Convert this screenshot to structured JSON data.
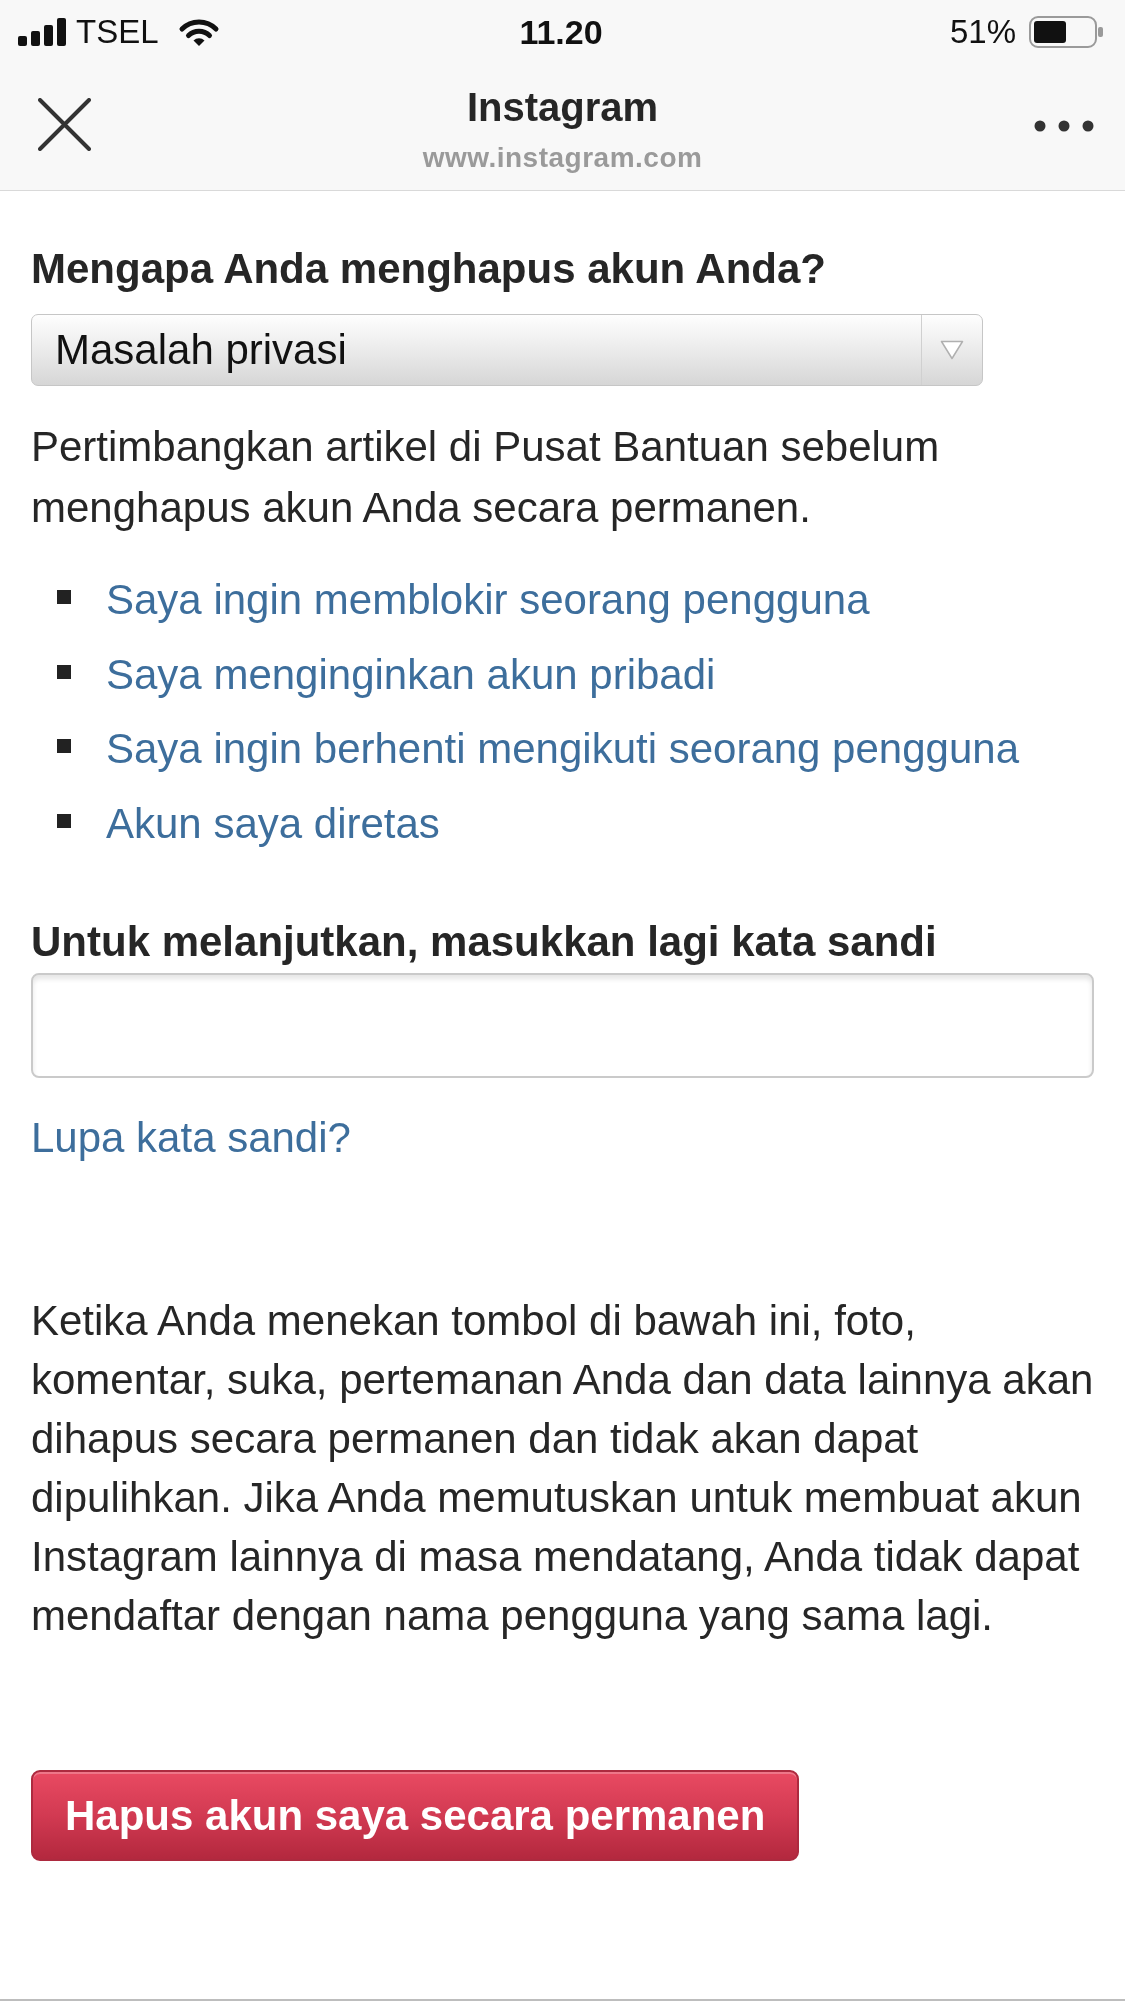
{
  "status_bar": {
    "carrier": "TSEL",
    "time": "11.20",
    "battery": "51%"
  },
  "browser_header": {
    "title": "Instagram",
    "url": "www.instagram.com"
  },
  "reason": {
    "question": "Mengapa Anda menghapus akun Anda?",
    "selected_option": "Masalah privasi"
  },
  "help": {
    "text": "Pertimbangkan artikel di Pusat Bantuan sebelum menghapus akun Anda secara permanen.",
    "links": [
      "Saya ingin memblokir seorang pengguna",
      "Saya menginginkan akun pribadi",
      "Saya ingin berhenti mengikuti seorang pengguna",
      "Akun saya diretas"
    ]
  },
  "password": {
    "label": "Untuk melanjutkan, masukkan lagi kata sandi",
    "forgot_link": "Lupa kata sandi?"
  },
  "warning": "Ketika Anda menekan tombol di bawah ini, foto,\nkomentar, suka, pertemanan Anda dan data lainnya akan\ndihapus secara permanen dan tidak akan dapat\ndipulihkan. Jika Anda memutuskan untuk membuat akun\nInstagram lainnya di masa mendatang, Anda tidak dapat\nmendaftar dengan nama pengguna yang sama lagi.",
  "delete_button": "Hapus akun saya secara permanen"
}
